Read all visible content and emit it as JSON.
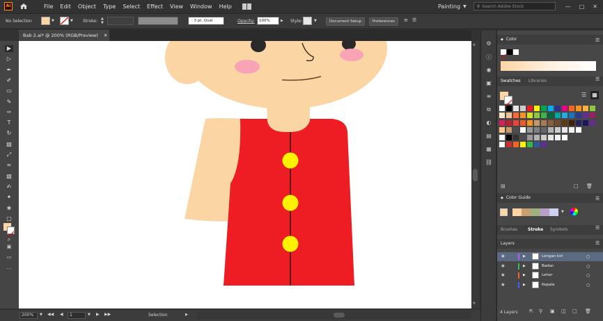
{
  "app": {
    "logo": "Ai",
    "workspace": "Painting",
    "search_placeholder": "Search Adobe Stock"
  },
  "menu": [
    "File",
    "Edit",
    "Object",
    "Type",
    "Select",
    "Effect",
    "View",
    "Window",
    "Help"
  ],
  "control": {
    "selection": "No Selection",
    "stroke_label": "Stroke:",
    "brush": "3 pt. Oval",
    "opacity_label": "Opacity:",
    "opacity": "100%",
    "style_label": "Style:",
    "doc_setup": "Document Setup",
    "preferences": "Preferences"
  },
  "document": {
    "tab_title": "Bab 2.ai* @ 200% (RGB/Preview)"
  },
  "status": {
    "zoom": "200%",
    "artboard": "1",
    "tool": "Selection"
  },
  "panels": {
    "color": "Color",
    "swatches_tab": "Swatches",
    "libraries_tab": "Libraries",
    "color_guide": "Color Guide",
    "brushes_tab": "Brushes",
    "stroke_tab": "Stroke",
    "symbols_tab": "Symbols",
    "layers": "Layers",
    "layers_count": "4 Layers"
  },
  "layers": [
    {
      "name": "Lengan kiri",
      "color": "#b060ff"
    },
    {
      "name": "Badan",
      "color": "#30c060"
    },
    {
      "name": "Leher",
      "color": "#ff6030"
    },
    {
      "name": "Kepala",
      "color": "#4060ff"
    }
  ],
  "colors": {
    "skin": "#fcd5a5",
    "shirt": "#ee1d23",
    "button": "#fff200",
    "cheek": "#f9a3b7",
    "accent_red": "#cf2d2d",
    "highlight": "#2c5aa0"
  }
}
